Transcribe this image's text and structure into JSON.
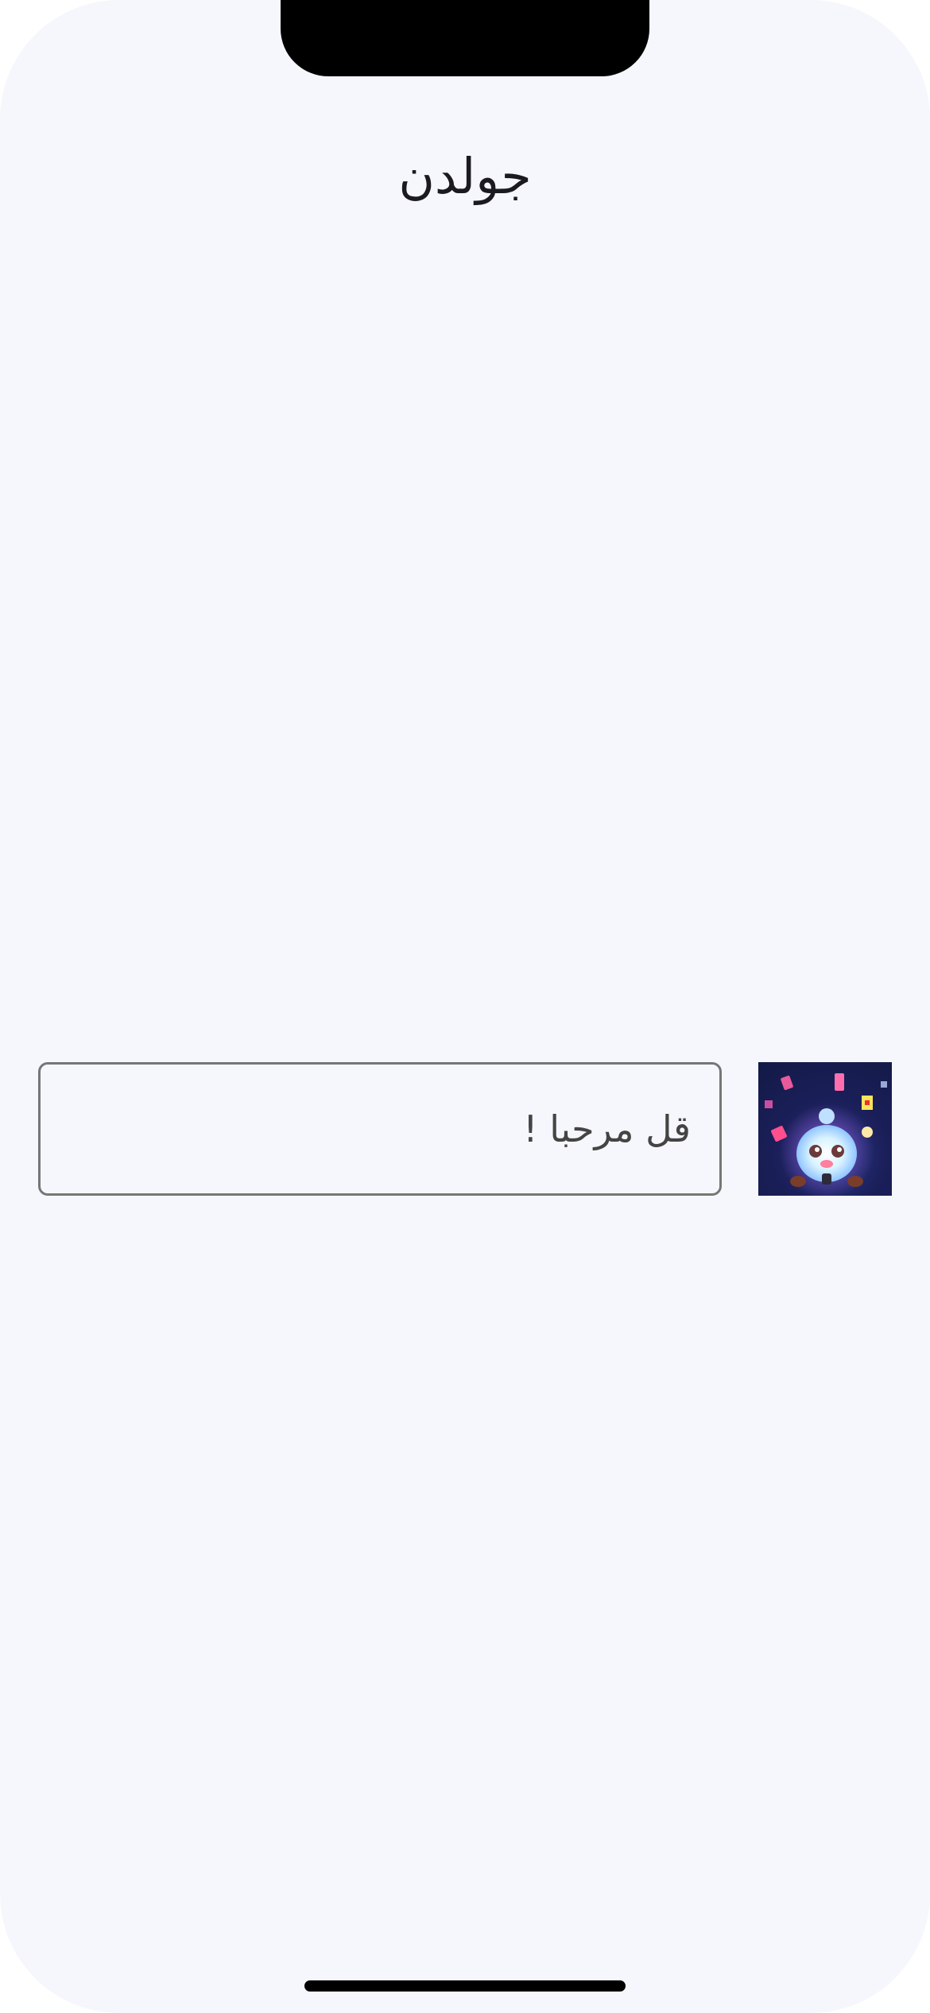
{
  "header": {
    "title": "جولدن"
  },
  "composer": {
    "placeholder": "قل مرحبا !",
    "value": "",
    "avatar_icon": "character-avatar-icon"
  },
  "colors": {
    "background": "#f6f7fc",
    "input_border": "#767676",
    "title_text": "#1b1b1f",
    "avatar_background": "#1b1f5a"
  }
}
